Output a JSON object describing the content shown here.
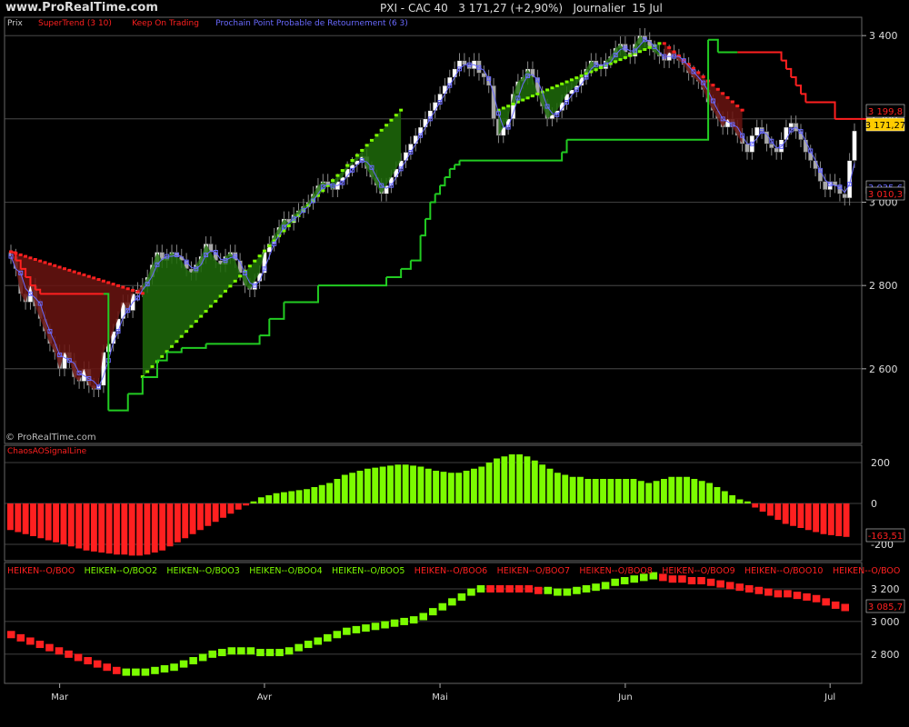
{
  "header": {
    "site": "www.ProRealTime.com",
    "instrument": "PXI - CAC 40",
    "price": "3 171,27 (+2,90%)",
    "period": "Journalier",
    "date": "15 Jul"
  },
  "panels": {
    "price": {
      "label_prefix": "Prix",
      "legend": [
        {
          "text": "SuperTrend (3 10)",
          "color": "#ff2020"
        },
        {
          "text": "Keep On Trading",
          "color": "#ff2020"
        },
        {
          "text": "Prochain Point Probable de Retournement (6 3)",
          "color": "#6a6aff"
        }
      ],
      "watermark": "© ProRealTime.com",
      "badges": [
        "3 199,8",
        "3 171,27",
        "3 035,6",
        "3 010,3"
      ]
    },
    "oscillator": {
      "legend": "ChaosAOSignalLine",
      "badge": "-163,51"
    },
    "heiken": {
      "legend": [
        {
          "text": "HEIKEN--O/BOO",
          "color": "#ff2020"
        },
        {
          "text": "HEIKEN--O/BOO2",
          "color": "#7cfc00"
        },
        {
          "text": "HEIKEN--O/BOO3",
          "color": "#7cfc00"
        },
        {
          "text": "HEIKEN--O/BOO4",
          "color": "#7cfc00"
        },
        {
          "text": "HEIKEN--O/BOO5",
          "color": "#7cfc00"
        },
        {
          "text": "HEIKEN--O/BOO6",
          "color": "#ff2020"
        },
        {
          "text": "HEIKEN--O/BOO7",
          "color": "#ff2020"
        },
        {
          "text": "HEIKEN--O/BOO8",
          "color": "#ff2020"
        },
        {
          "text": "HEIKEN--O/BOO9",
          "color": "#ff2020"
        },
        {
          "text": "HEIKEN--O/BOO10",
          "color": "#ff2020"
        },
        {
          "text": "HEIKEN--O/BOO",
          "color": "#ff2020"
        }
      ],
      "badge": "3 085,7"
    }
  },
  "colors": {
    "bull": "#7cfc00",
    "bear": "#ff2020",
    "trail": "#22cc22",
    "pivot": "#6a6aff",
    "fill_bull": "#1e6b0a",
    "fill_bear": "#6a1410",
    "candle_up": "#ffffff",
    "candle_down": "#a8a8a8",
    "grid": "#555555",
    "badge_yellow": "#ffcc00"
  },
  "chart_data": [
    {
      "type": "candlestick",
      "title": "PXI - CAC 40",
      "ylim": [
        2460,
        3420
      ],
      "y_ticks": [
        2600,
        2800,
        3000,
        3200,
        3400
      ],
      "y_tick_labels": [
        "2 600",
        "2 800",
        "3 000",
        "3 200",
        "3 400"
      ],
      "x_month_labels": [
        {
          "label": "Mar",
          "index": 10
        },
        {
          "label": "Avr",
          "index": 52
        },
        {
          "label": "Mai",
          "index": 88
        },
        {
          "label": "Jun",
          "index": 126
        },
        {
          "label": "Jul",
          "index": 168
        }
      ],
      "close": [
        2870,
        2840,
        2780,
        2760,
        2800,
        2750,
        2720,
        2690,
        2660,
        2640,
        2600,
        2640,
        2620,
        2580,
        2570,
        2600,
        2560,
        2550,
        2560,
        2640,
        2660,
        2690,
        2720,
        2760,
        2740,
        2780,
        2790,
        2800,
        2820,
        2850,
        2880,
        2860,
        2870,
        2880,
        2870,
        2860,
        2840,
        2830,
        2850,
        2870,
        2900,
        2880,
        2860,
        2850,
        2870,
        2880,
        2860,
        2830,
        2800,
        2790,
        2810,
        2830,
        2880,
        2900,
        2920,
        2940,
        2960,
        2950,
        2970,
        2980,
        2990,
        3000,
        3020,
        3040,
        3050,
        3040,
        3030,
        3050,
        3060,
        3080,
        3090,
        3100,
        3110,
        3080,
        3060,
        3040,
        3020,
        3040,
        3060,
        3080,
        3100,
        3120,
        3140,
        3160,
        3180,
        3200,
        3220,
        3240,
        3260,
        3280,
        3300,
        3320,
        3340,
        3330,
        3320,
        3340,
        3310,
        3300,
        3280,
        3200,
        3160,
        3180,
        3200,
        3260,
        3290,
        3300,
        3320,
        3300,
        3260,
        3230,
        3200,
        3210,
        3220,
        3240,
        3260,
        3270,
        3280,
        3300,
        3320,
        3340,
        3330,
        3320,
        3340,
        3350,
        3370,
        3380,
        3360,
        3350,
        3380,
        3400,
        3390,
        3370,
        3360,
        3350,
        3340,
        3360,
        3350,
        3340,
        3330,
        3310,
        3300,
        3290,
        3270,
        3240,
        3220,
        3200,
        3180,
        3200,
        3180,
        3160,
        3140,
        3120,
        3160,
        3180,
        3170,
        3140,
        3130,
        3120,
        3150,
        3180,
        3190,
        3170,
        3150,
        3120,
        3100,
        3080,
        3050,
        3030,
        3050,
        3040,
        3020,
        3010,
        3100,
        3171.27
      ],
      "supertrend": {
        "bear_segments": [
          [
            0,
            27,
            2880,
            2780
          ],
          [
            134,
            150,
            3380,
            3220
          ]
        ],
        "bull_segments": [
          [
            27,
            80,
            2580,
            3220
          ],
          [
            100,
            133,
            3220,
            3380
          ]
        ]
      },
      "trailing_stop": [
        2880,
        2860,
        2840,
        2820,
        2800,
        2790,
        2780,
        2780,
        2780,
        2780,
        2780,
        2780,
        2780,
        2780,
        2780,
        2780,
        2780,
        2780,
        2780,
        2780,
        2500,
        2500,
        2500,
        2500,
        2540,
        2540,
        2540,
        2580,
        2580,
        2580,
        2620,
        2620,
        2640,
        2640,
        2640,
        2650,
        2650,
        2650,
        2650,
        2650,
        2660,
        2660,
        2660,
        2660,
        2660,
        2660,
        2660,
        2660,
        2660,
        2660,
        2660,
        2680,
        2680,
        2720,
        2720,
        2720,
        2760,
        2760,
        2760,
        2760,
        2760,
        2760,
        2760,
        2800,
        2800,
        2800,
        2800,
        2800,
        2800,
        2800,
        2800,
        2800,
        2800,
        2800,
        2800,
        2800,
        2800,
        2820,
        2820,
        2820,
        2840,
        2840,
        2860,
        2860,
        2920,
        2960,
        3000,
        3020,
        3040,
        3060,
        3080,
        3090,
        3100,
        3100,
        3100,
        3100,
        3100,
        3100,
        3100,
        3100,
        3100,
        3100,
        3100,
        3100,
        3100,
        3100,
        3100,
        3100,
        3100,
        3100,
        3100,
        3100,
        3100,
        3120,
        3150,
        3150,
        3150,
        3150,
        3150,
        3150,
        3150,
        3150,
        3150,
        3150,
        3150,
        3150,
        3150,
        3150,
        3150,
        3150,
        3150,
        3150,
        3150,
        3150,
        3150,
        3150,
        3150,
        3150,
        3150,
        3150,
        3150,
        3150,
        3150,
        3390,
        3390,
        3360,
        3360,
        3360,
        3360,
        3360,
        3360,
        3360,
        3360,
        3360,
        3360,
        3360,
        3360,
        3360,
        3340,
        3320,
        3300,
        3280,
        3260,
        3240,
        3240,
        3240,
        3240,
        3240,
        3240,
        3200,
        3200,
        3200,
        3200,
        3200,
        3200,
        3200,
        3200,
        3200
      ]
    },
    {
      "type": "bar",
      "title": "ChaosAOSignalLine",
      "ylim": [
        -240,
        240
      ],
      "y_ticks": [
        -200,
        0,
        200
      ],
      "y_tick_labels": [
        "-200",
        "0",
        "200"
      ],
      "values": [
        -130,
        -140,
        -150,
        -160,
        -170,
        -180,
        -190,
        -200,
        -210,
        -220,
        -230,
        -235,
        -240,
        -245,
        -250,
        -250,
        -255,
        -255,
        -250,
        -240,
        -230,
        -210,
        -190,
        -170,
        -150,
        -130,
        -110,
        -90,
        -70,
        -50,
        -30,
        -10,
        10,
        30,
        40,
        50,
        55,
        60,
        65,
        70,
        80,
        90,
        100,
        120,
        140,
        150,
        160,
        170,
        175,
        180,
        185,
        190,
        190,
        185,
        180,
        170,
        160,
        155,
        150,
        150,
        160,
        170,
        180,
        200,
        220,
        230,
        240,
        240,
        230,
        210,
        190,
        170,
        150,
        140,
        130,
        130,
        120,
        120,
        120,
        120,
        120,
        120,
        120,
        110,
        100,
        110,
        120,
        130,
        130,
        130,
        120,
        110,
        100,
        80,
        60,
        40,
        20,
        10,
        -20,
        -40,
        -60,
        -80,
        -100,
        -110,
        -120,
        -130,
        -140,
        -150,
        -155,
        -160,
        -163.51
      ]
    },
    {
      "type": "scatter",
      "title": "HEIKEN--O/BOO",
      "ylim": [
        2660,
        3300
      ],
      "y_ticks": [
        2800,
        3000,
        3200
      ],
      "y_tick_labels": [
        "2 800",
        "3 000",
        "3 200"
      ],
      "values": [
        2920,
        2900,
        2880,
        2860,
        2840,
        2820,
        2800,
        2780,
        2760,
        2740,
        2720,
        2700,
        2690,
        2690,
        2690,
        2700,
        2710,
        2720,
        2740,
        2760,
        2780,
        2800,
        2810,
        2820,
        2820,
        2820,
        2810,
        2810,
        2810,
        2820,
        2840,
        2860,
        2880,
        2900,
        2920,
        2940,
        2950,
        2960,
        2970,
        2980,
        2990,
        3000,
        3010,
        3030,
        3060,
        3090,
        3120,
        3150,
        3180,
        3200,
        3200,
        3200,
        3200,
        3200,
        3200,
        3190,
        3190,
        3180,
        3180,
        3190,
        3200,
        3210,
        3220,
        3240,
        3250,
        3260,
        3270,
        3280,
        3270,
        3260,
        3260,
        3250,
        3250,
        3240,
        3230,
        3220,
        3210,
        3200,
        3190,
        3180,
        3170,
        3170,
        3160,
        3150,
        3140,
        3120,
        3100,
        3085.7
      ],
      "colors_segments": [
        [
          0,
          12,
          "bear"
        ],
        [
          12,
          50,
          "bull"
        ],
        [
          50,
          56,
          "bear"
        ],
        [
          56,
          68,
          "bull"
        ],
        [
          68,
          88,
          "bear"
        ]
      ]
    }
  ]
}
